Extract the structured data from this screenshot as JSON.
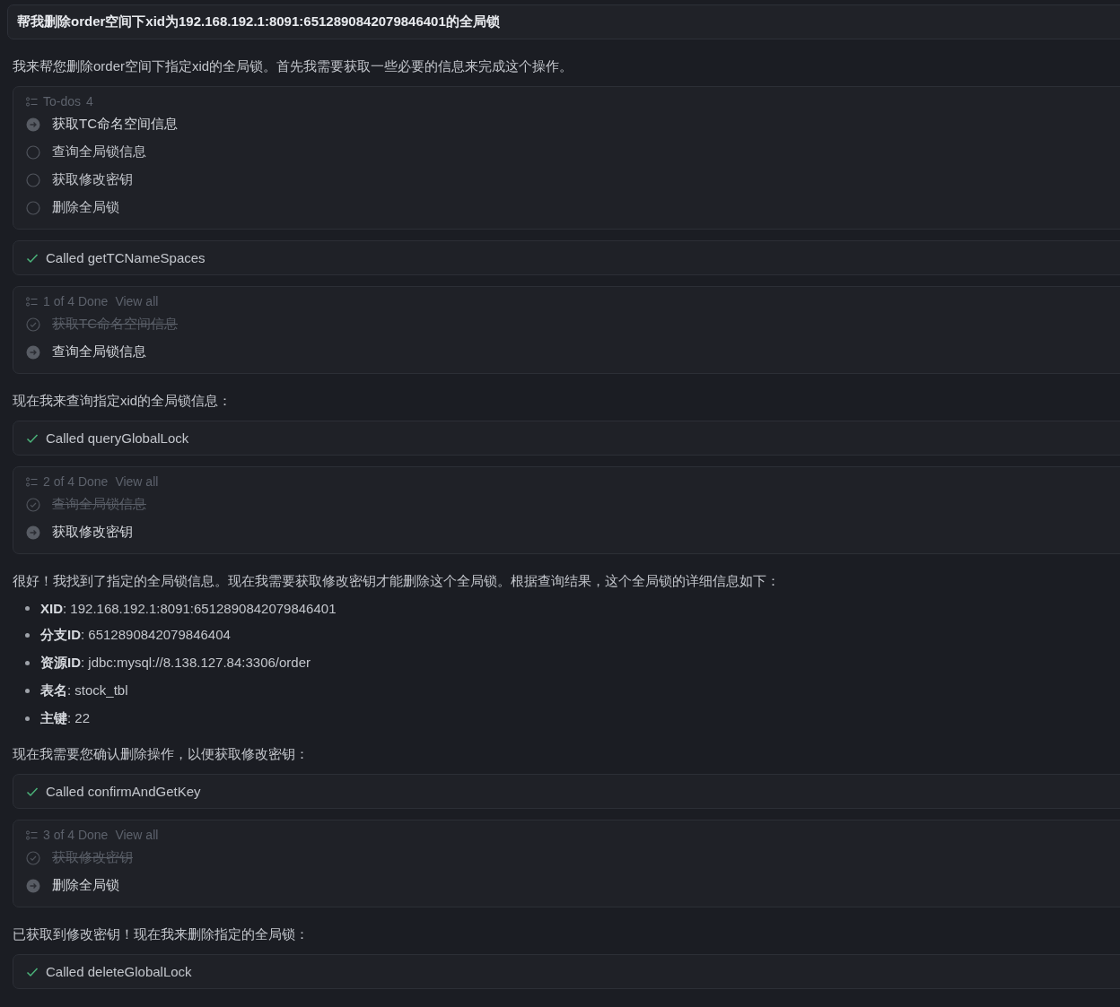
{
  "user_message": "帮我删除order空间下xid为192.168.192.1:8091:6512890842079846401的全局锁",
  "blocks": [
    {
      "kind": "paragraph",
      "text": "我来帮您删除order空间下指定xid的全局锁。首先我需要获取一些必要的信息来完成这个操作。"
    },
    {
      "kind": "todo",
      "title": "To-dos",
      "count": "4",
      "items": [
        {
          "label": "获取TC命名空间信息",
          "done": false,
          "active": true
        },
        {
          "label": "查询全局锁信息",
          "done": false,
          "active": false
        },
        {
          "label": "获取修改密钥",
          "done": false,
          "active": false
        },
        {
          "label": "删除全局锁",
          "done": false,
          "active": false
        }
      ]
    },
    {
      "kind": "tool_call",
      "text": "Called getTCNameSpaces"
    },
    {
      "kind": "todo",
      "title": "1 of 4 Done",
      "link": "View all",
      "items": [
        {
          "label": "获取TC命名空间信息",
          "done": true
        },
        {
          "label": "查询全局锁信息",
          "done": false,
          "active": true
        }
      ]
    },
    {
      "kind": "paragraph",
      "text": "现在我来查询指定xid的全局锁信息："
    },
    {
      "kind": "tool_call",
      "text": "Called queryGlobalLock"
    },
    {
      "kind": "todo",
      "title": "2 of 4 Done",
      "link": "View all",
      "items": [
        {
          "label": "查询全局锁信息",
          "done": true
        },
        {
          "label": "获取修改密钥",
          "done": false,
          "active": true
        }
      ]
    },
    {
      "kind": "paragraph",
      "text": "很好！我找到了指定的全局锁信息。现在我需要获取修改密钥才能删除这个全局锁。根据查询结果，这个全局锁的详细信息如下："
    },
    {
      "kind": "bullets",
      "items": [
        "**XID**: 192.168.192.1:8091:6512890842079846401",
        "**分支ID**: 6512890842079846404",
        "**资源ID**: jdbc:mysql://8.138.127.84:3306/order",
        "**表名**: stock_tbl",
        "**主键**: 22"
      ]
    },
    {
      "kind": "paragraph",
      "text": "现在我需要您确认删除操作，以便获取修改密钥："
    },
    {
      "kind": "tool_call",
      "text": "Called confirmAndGetKey"
    },
    {
      "kind": "todo",
      "title": "3 of 4 Done",
      "link": "View all",
      "items": [
        {
          "label": "获取修改密钥",
          "done": true
        },
        {
          "label": "删除全局锁",
          "done": false,
          "active": true
        }
      ]
    },
    {
      "kind": "paragraph",
      "text": "已获取到修改密钥！现在我来删除指定的全局锁："
    },
    {
      "kind": "tool_call",
      "text": "Called deleteGlobalLock"
    }
  ]
}
